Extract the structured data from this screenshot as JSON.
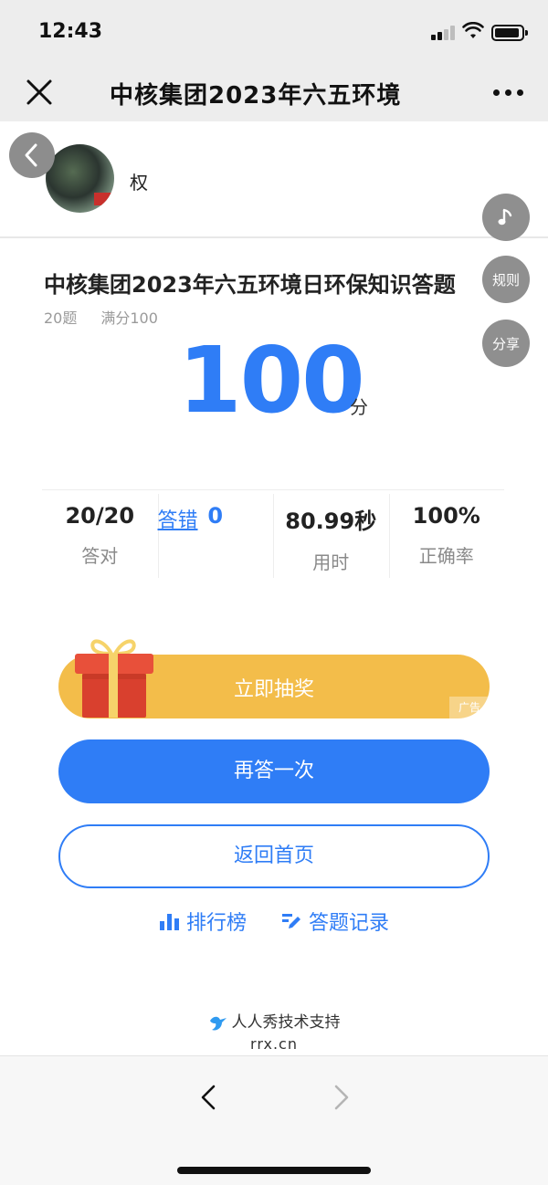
{
  "status_bar": {
    "time": "12:43"
  },
  "nav": {
    "title": "中核集团2023年六五环境"
  },
  "user": {
    "name": "权"
  },
  "side_buttons": {
    "rules": "规则",
    "share": "分享"
  },
  "quiz": {
    "title": "中核集团2023年六五环境日环保知识答题",
    "question_count": "20题",
    "full_score": "满分100",
    "score": "100",
    "score_unit": "分"
  },
  "stats": [
    {
      "value": "20/20",
      "label": "答对"
    },
    {
      "value": "0",
      "label": "答错"
    },
    {
      "value": "80.99秒",
      "label": "用时"
    },
    {
      "value": "100%",
      "label": "正确率"
    }
  ],
  "buttons": {
    "lottery": "立即抽奖",
    "ad_tag": "广告",
    "retry": "再答一次",
    "home": "返回首页"
  },
  "links": {
    "ranking": "排行榜",
    "records": "答题记录"
  },
  "footer": {
    "brand": "人人秀技术支持",
    "url": "rrx.cn"
  },
  "colors": {
    "primary": "#2f7df6",
    "lottery": "#f3bd4a",
    "gift": "#e8503a"
  }
}
